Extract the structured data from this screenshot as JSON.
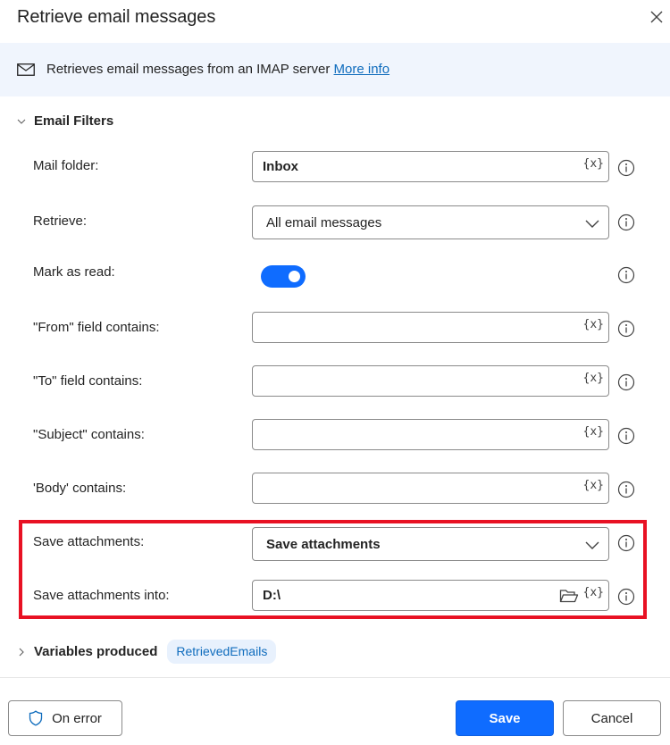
{
  "dialog": {
    "title": "Retrieve email messages",
    "close_icon": "close-icon"
  },
  "banner": {
    "icon": "mail-icon",
    "description": "Retrieves email messages from an IMAP server",
    "link_label": "More info"
  },
  "section": {
    "label": "Email Filters",
    "expanded": true
  },
  "fields": {
    "mail_folder": {
      "label": "Mail folder:",
      "value": "Inbox",
      "var_label": "{x}"
    },
    "retrieve": {
      "label": "Retrieve:",
      "value": "All email messages"
    },
    "mark_as_read": {
      "label": "Mark as read:",
      "checked": true
    },
    "from": {
      "label": "\"From\" field contains:",
      "value": "",
      "var_label": "{x}"
    },
    "to": {
      "label": "\"To\" field contains:",
      "value": "",
      "var_label": "{x}"
    },
    "subject": {
      "label": "\"Subject\" contains:",
      "value": "",
      "var_label": "{x}"
    },
    "body": {
      "label": "'Body' contains:",
      "value": "",
      "var_label": "{x}"
    },
    "save_attachments": {
      "label": "Save attachments:",
      "value": "Save attachments"
    },
    "save_into": {
      "label": "Save attachments into:",
      "value": "D:\\",
      "var_label": "{x}"
    }
  },
  "variables": {
    "label": "Variables produced",
    "items": [
      "RetrievedEmails"
    ]
  },
  "footer": {
    "on_error_label": "On error",
    "save_label": "Save",
    "cancel_label": "Cancel"
  },
  "colors": {
    "accent": "#0f6cff",
    "highlight": "#e81123",
    "banner_bg": "#f0f5fd",
    "link": "#0f6cbd"
  }
}
